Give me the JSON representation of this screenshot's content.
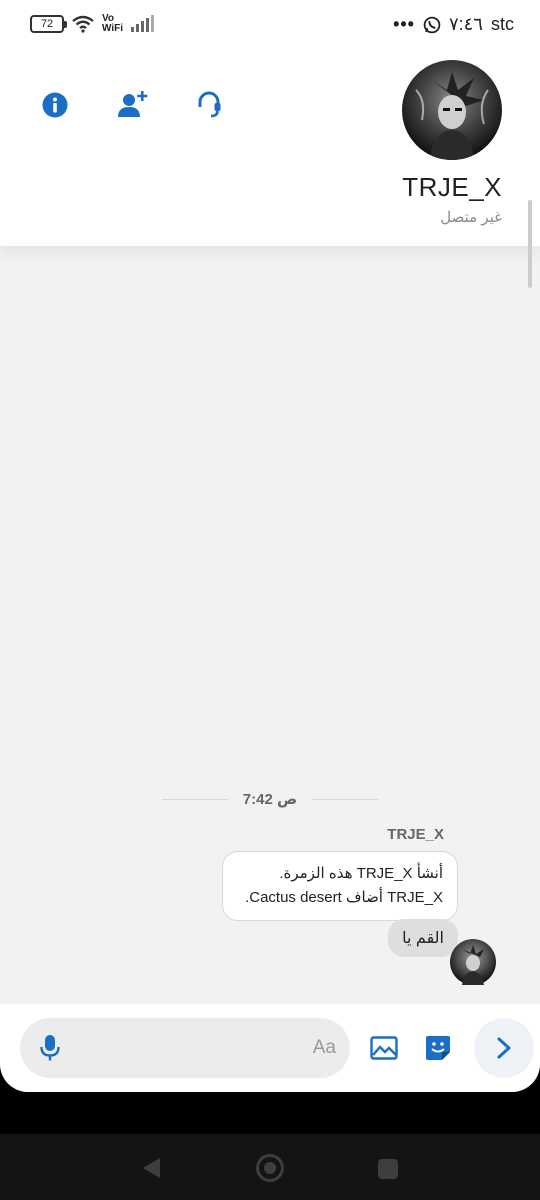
{
  "status_bar": {
    "battery": "72",
    "network_label_top": "Vo",
    "network_label_bottom": "WiFi",
    "time": "٧:٤٦",
    "carrier": "stc",
    "more": "•••"
  },
  "header": {
    "contact_name": "TRJE_X",
    "contact_status": "غير متصل",
    "icons": [
      "info-icon",
      "add-user-icon",
      "call-icon"
    ]
  },
  "chat": {
    "time_divider": "7:42 ص",
    "sender_name": "TRJE_X",
    "system_message_line1": "أنشأ TRJE_X هذه الزمرة.",
    "system_message_line2": "TRJE_X أضاف Cactus desert.",
    "message_text": "القم يا"
  },
  "composer": {
    "placeholder": "Aa"
  },
  "colors": {
    "accent": "#1a6fc4",
    "background": "#f2f2f2"
  }
}
